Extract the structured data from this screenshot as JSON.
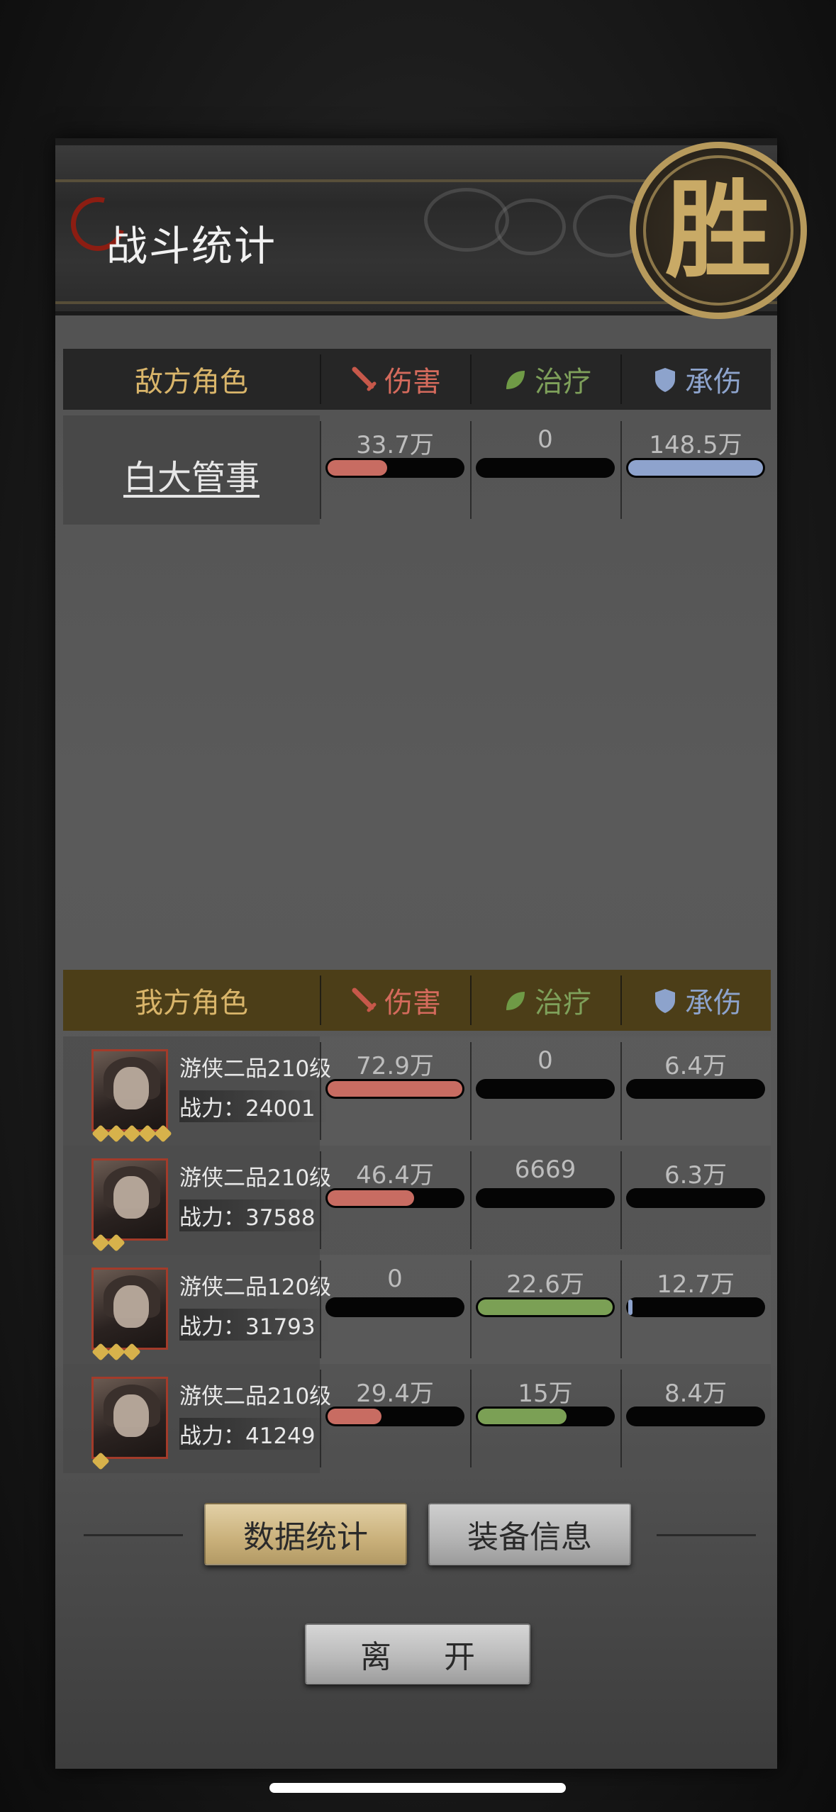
{
  "header": {
    "title": "战斗统计",
    "result_seal": "胜"
  },
  "columns": {
    "damage": "伤害",
    "heal": "治疗",
    "tank": "承伤"
  },
  "enemy": {
    "header_label": "敌方角色",
    "rows": [
      {
        "name": "白大管事",
        "damage": "33.7万",
        "damage_pct": 44,
        "heal": "0",
        "heal_pct": 0,
        "tank": "148.5万",
        "tank_pct": 100
      }
    ]
  },
  "ally": {
    "header_label": "我方角色",
    "rows": [
      {
        "class": "游侠二品210级",
        "power_label": "战力：24001",
        "stars": 5,
        "damage": "72.9万",
        "damage_pct": 100,
        "heal": "0",
        "heal_pct": 0,
        "tank": "6.4万",
        "tank_pct": 0
      },
      {
        "class": "游侠二品210级",
        "power_label": "战力：37588",
        "stars": 2,
        "damage": "46.4万",
        "damage_pct": 64,
        "heal": "6669",
        "heal_pct": 0,
        "tank": "6.3万",
        "tank_pct": 0
      },
      {
        "class": "游侠二品120级",
        "power_label": "战力：31793",
        "stars": 3,
        "damage": "0",
        "damage_pct": 0,
        "heal": "22.6万",
        "heal_pct": 100,
        "tank": "12.7万",
        "tank_pct": 3
      },
      {
        "class": "游侠二品210级",
        "power_label": "战力：41249",
        "stars": 1,
        "damage": "29.4万",
        "damage_pct": 40,
        "heal": "15万",
        "heal_pct": 66,
        "tank": "8.4万",
        "tank_pct": 0
      }
    ]
  },
  "buttons": {
    "stats": "数据统计",
    "equipment": "装备信息",
    "leave": "离 开"
  },
  "colors": {
    "damage": "#d46a5c",
    "heal": "#7ea05a",
    "tank": "#8da3cc",
    "gold": "#d9b56a"
  }
}
